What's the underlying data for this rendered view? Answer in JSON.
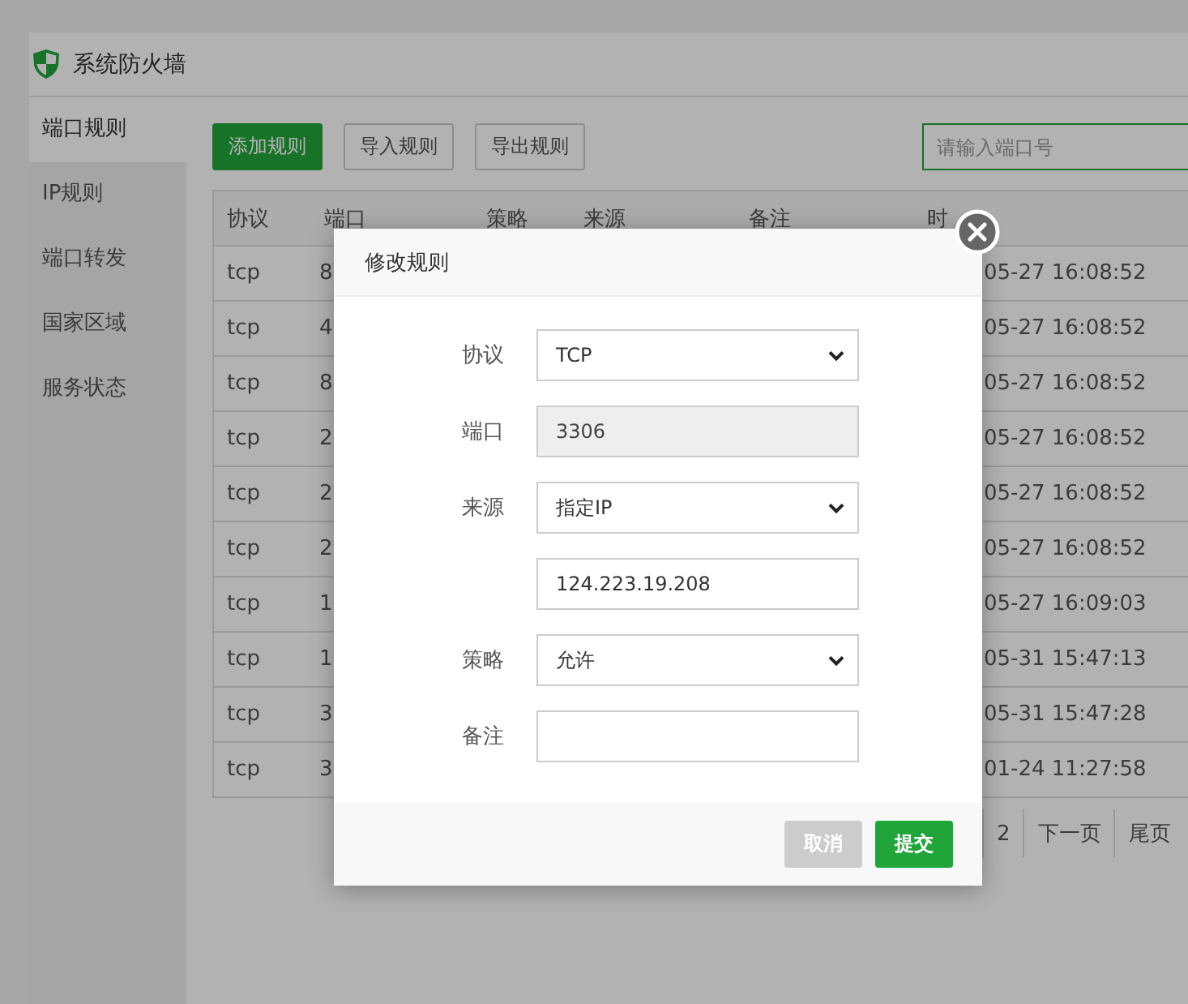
{
  "window": {
    "title": "系统防火墙"
  },
  "sidebar": {
    "items": [
      {
        "label": "端口规则",
        "selected": true
      },
      {
        "label": "IP规则",
        "selected": false
      },
      {
        "label": "端口转发",
        "selected": false
      },
      {
        "label": "国家区域",
        "selected": false
      },
      {
        "label": "服务状态",
        "selected": false
      }
    ]
  },
  "toolbar": {
    "buttons": [
      {
        "label": "添加规则",
        "kind": "primary"
      },
      {
        "label": "导入规则",
        "kind": "default"
      },
      {
        "label": "导出规则",
        "kind": "default"
      }
    ],
    "search": {
      "placeholder": "请输入端口号"
    }
  },
  "table": {
    "columns": [
      "协议",
      "端口",
      "策略",
      "来源",
      "备注",
      "时"
    ],
    "rows": [
      {
        "protocol": "tcp",
        "port": "8",
        "time": "05-27 16:08:52"
      },
      {
        "protocol": "tcp",
        "port": "4",
        "time": "05-27 16:08:52"
      },
      {
        "protocol": "tcp",
        "port": "8",
        "time": "05-27 16:08:52"
      },
      {
        "protocol": "tcp",
        "port": "2",
        "time": "05-27 16:08:52"
      },
      {
        "protocol": "tcp",
        "port": "2",
        "time": "05-27 16:08:52"
      },
      {
        "protocol": "tcp",
        "port": "2",
        "time": "05-27 16:08:52"
      },
      {
        "protocol": "tcp",
        "port": "1",
        "time": "05-27 16:09:03"
      },
      {
        "protocol": "tcp",
        "port": "1",
        "time": "05-31 15:47:13"
      },
      {
        "protocol": "tcp",
        "port": "3",
        "time": "05-31 15:47:28"
      },
      {
        "protocol": "tcp",
        "port": "3",
        "time": "01-24 11:27:58"
      }
    ]
  },
  "pagination": {
    "items": [
      {
        "label": "2"
      },
      {
        "label": "下一页"
      },
      {
        "label": "尾页"
      }
    ]
  },
  "dialog": {
    "title": "修改规则",
    "fields": [
      {
        "label": "协议",
        "kind": "select",
        "value": "TCP",
        "disabled": false
      },
      {
        "label": "端口",
        "kind": "input",
        "value": "3306",
        "disabled": true
      },
      {
        "label": "来源",
        "kind": "select",
        "value": "指定IP",
        "disabled": false
      },
      {
        "kind": "input",
        "value": "124.223.19.208",
        "disabled": false
      },
      {
        "label": "策略",
        "kind": "select",
        "value": "允许",
        "disabled": false
      },
      {
        "label": "备注",
        "kind": "input",
        "disabled": false
      }
    ],
    "buttons": [
      {
        "label": "取消",
        "disabled": true
      },
      {
        "label": "提交",
        "disabled": false
      }
    ]
  }
}
